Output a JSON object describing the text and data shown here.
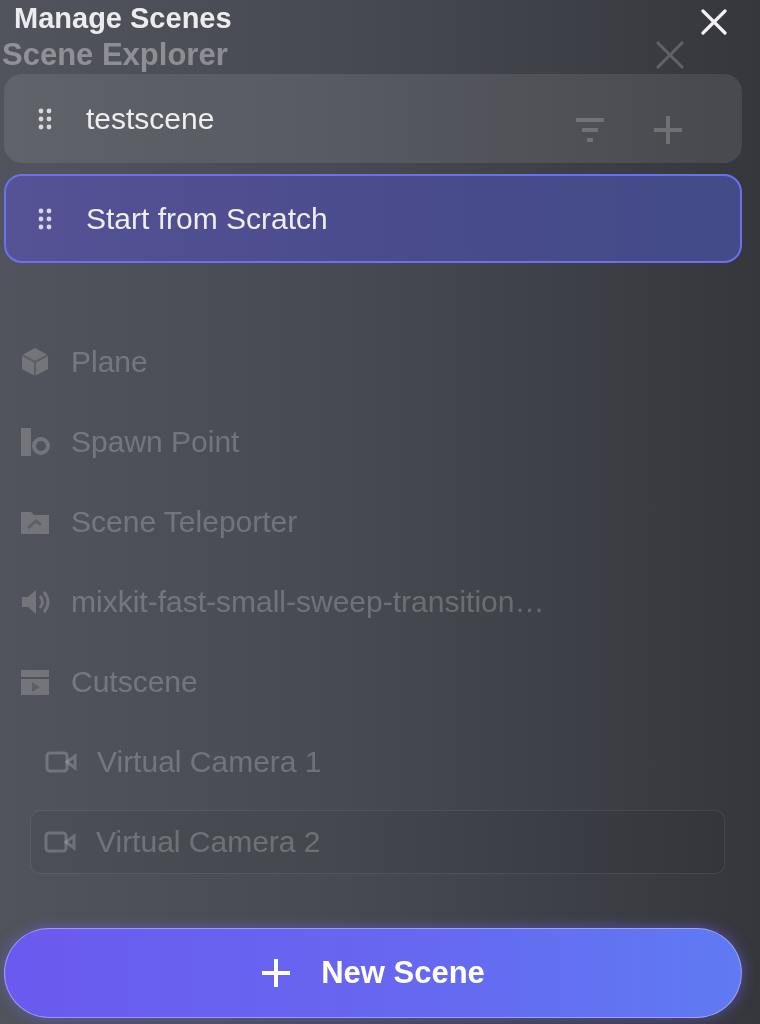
{
  "background_panel": {
    "title": "Scene Explorer",
    "items": [
      {
        "label": "Plane",
        "kind": "cube",
        "selected": false
      },
      {
        "label": "Spawn Point",
        "kind": "spawn",
        "selected": false
      },
      {
        "label": "Scene Teleporter",
        "kind": "teleporter",
        "selected": false
      },
      {
        "label": "mixkit-fast-small-sweep-transition…",
        "kind": "audio",
        "selected": false
      },
      {
        "label": "Cutscene",
        "kind": "cutscene",
        "selected": false,
        "children": [
          {
            "label": "Virtual Camera 1",
            "kind": "camera",
            "selected": false
          },
          {
            "label": "Virtual Camera 2",
            "kind": "camera",
            "selected": true
          }
        ]
      }
    ]
  },
  "dialog": {
    "title": "Manage Scenes",
    "scenes": [
      {
        "label": "testscene",
        "selected": false
      },
      {
        "label": "Start from Scratch",
        "selected": true
      }
    ],
    "new_button": {
      "label": "New Scene"
    }
  }
}
